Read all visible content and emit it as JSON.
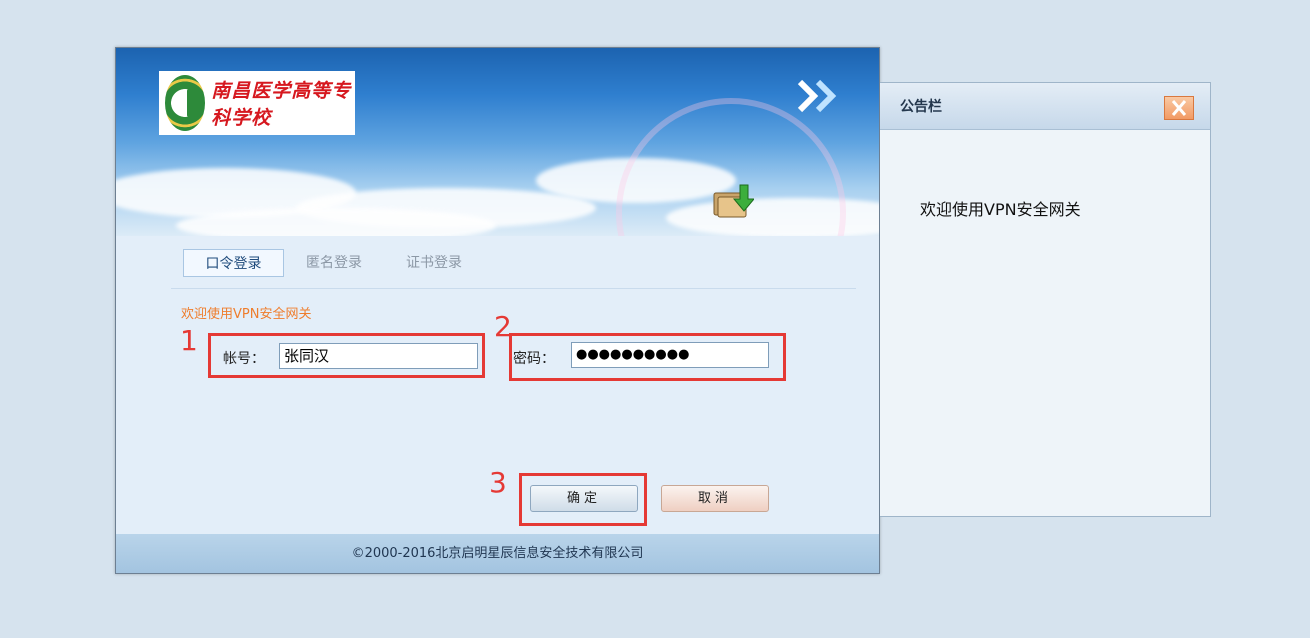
{
  "login": {
    "logo_text": "南昌医学高等专科学校",
    "tabs": [
      {
        "label": "口令登录",
        "active": true
      },
      {
        "label": "匿名登录",
        "active": false
      },
      {
        "label": "证书登录",
        "active": false
      }
    ],
    "welcome": "欢迎使用VPN安全网关",
    "account_label": "帐号：",
    "account_value": "张同汉",
    "password_label": "密码：",
    "password_value": "●●●●●●●●●●",
    "ok_label": "确定",
    "cancel_label": "取消",
    "footer": "©2000-2016北京启明星辰信息安全技术有限公司"
  },
  "annotations": {
    "n1": "1",
    "n2": "2",
    "n3": "3",
    "color": "#e53935"
  },
  "notice": {
    "title": "公告栏",
    "body": "欢迎使用VPN安全网关"
  }
}
